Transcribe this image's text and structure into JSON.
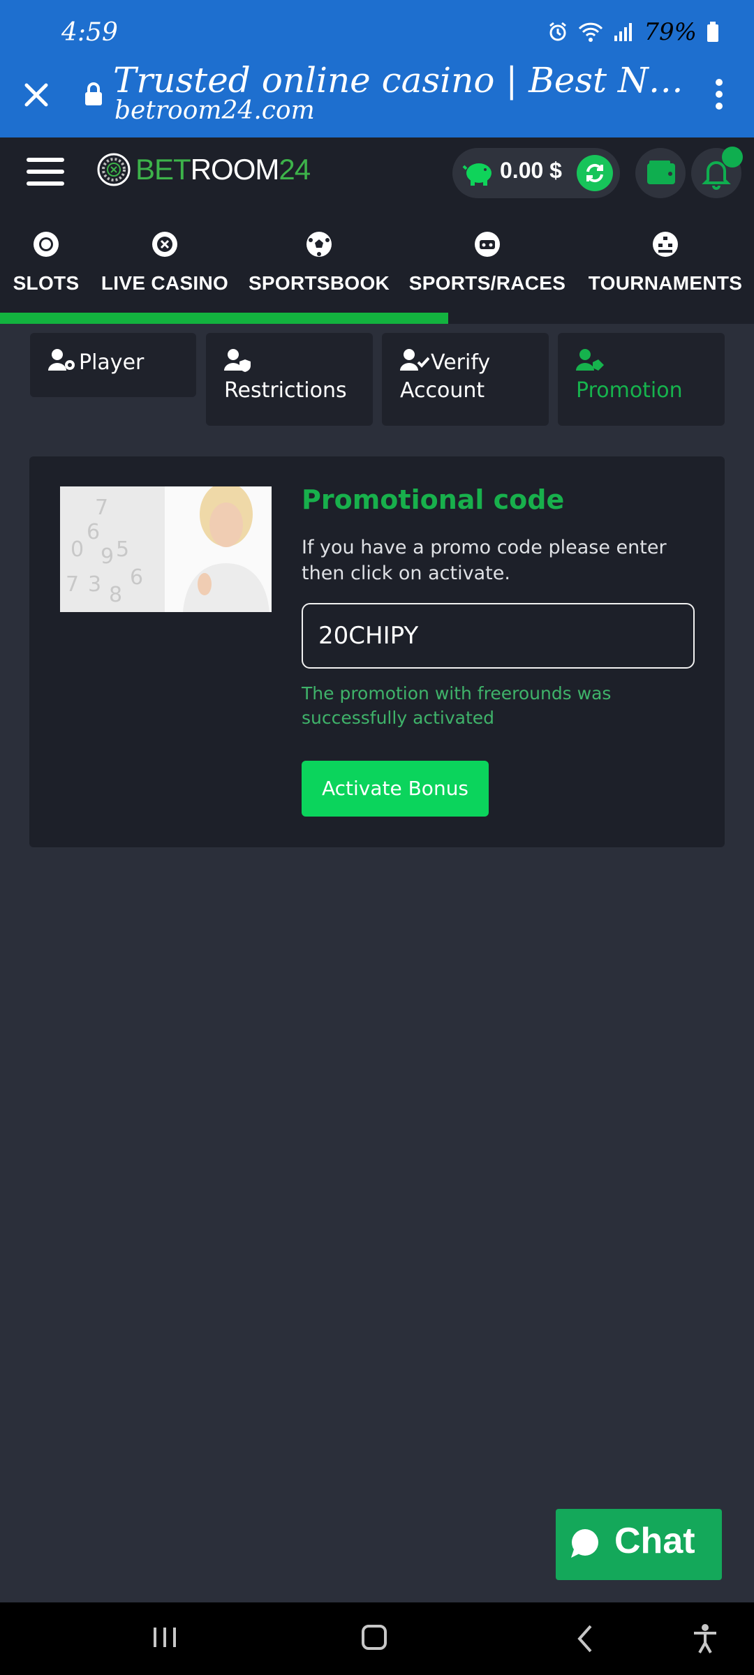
{
  "status_bar": {
    "time": "4:59",
    "battery": "79%",
    "icons": [
      "alarm-icon",
      "wifi-icon",
      "signal-icon",
      "battery-icon"
    ]
  },
  "browser": {
    "title": "Trusted online casino | Best No W...",
    "url": "betroom24.com",
    "close_icon": "close-icon",
    "lock_icon": "lock-icon",
    "menu_icon": "more-vert-icon"
  },
  "header": {
    "logo_part1": "BET",
    "logo_part2": "ROOM",
    "logo_part3": "24",
    "balance": "0.00 $",
    "icons": [
      "menu-icon",
      "piggy-bank-icon",
      "refresh-icon",
      "wallet-icon",
      "bell-icon"
    ]
  },
  "nav": {
    "items": [
      {
        "label": "SLOTS",
        "icon": "slots-icon"
      },
      {
        "label": "LIVE CASINO",
        "icon": "roulette-icon"
      },
      {
        "label": "SPORTSBOOK",
        "icon": "soccer-ball-icon"
      },
      {
        "label": "SPORTS/RACES",
        "icon": "vr-headset-icon"
      },
      {
        "label": "TOURNAMENTS",
        "icon": "bracket-icon"
      }
    ],
    "progress_fraction": 0.59
  },
  "tabs": [
    {
      "label": "Player",
      "icon": "user-gear-icon"
    },
    {
      "label": "Restrictions",
      "icon": "user-shield-icon"
    },
    {
      "label": "Verify Account",
      "icon": "user-check-icon"
    },
    {
      "label": "Promotion",
      "icon": "user-tag-icon",
      "active": true
    }
  ],
  "promo": {
    "title": "Promotional code",
    "description": "If you have a promo code please enter then click on activate.",
    "code_value": "20CHIPY",
    "success_message": "The promotion with freerounds was successfully activated",
    "button_label": "Activate Bonus"
  },
  "chat": {
    "label": "Chat",
    "icon": "chat-bubble-icon"
  },
  "system_nav": {
    "icons": [
      "recent-apps-icon",
      "home-icon",
      "back-icon",
      "accessibility-icon"
    ]
  },
  "colors": {
    "browser_blue": "#1e6fcf",
    "accent_green": "#18b04c",
    "button_green": "#0bd45c",
    "page_bg": "#2b2f3a",
    "panel_bg": "#1d2029"
  }
}
